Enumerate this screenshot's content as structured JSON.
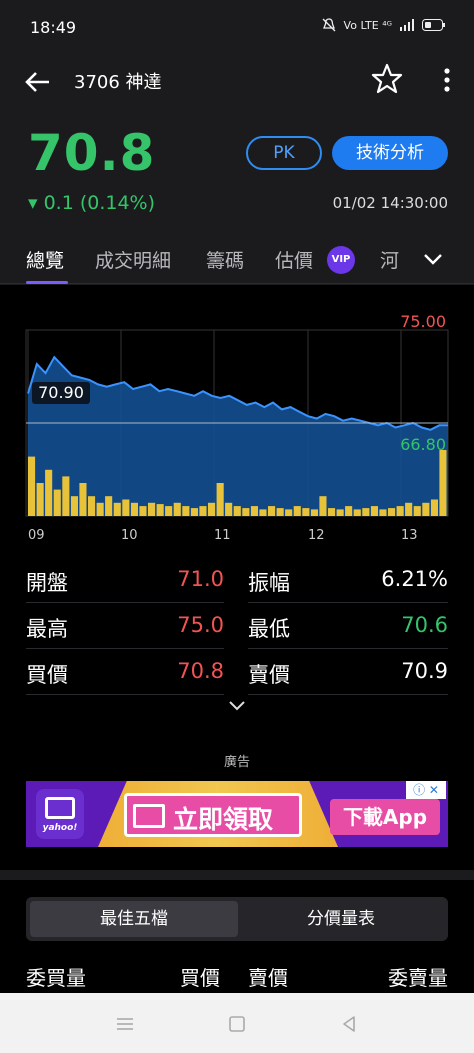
{
  "status_bar": {
    "time": "18:49",
    "indicators": "Vo LTE ⁴ᴳ"
  },
  "header": {
    "title": "3706 神達"
  },
  "quote": {
    "price": "70.8",
    "change": "▾ 0.1 (0.14%)",
    "pk_label": "PK",
    "tech_label": "技術分析",
    "timestamp": "01/02 14:30:00"
  },
  "tabs": [
    "總覽",
    "成交明細",
    "籌碼",
    "估價",
    "河"
  ],
  "vip_badge": "VIP",
  "chart_data": {
    "type": "area",
    "x_ticks": [
      "09",
      "10",
      "11",
      "12",
      "13"
    ],
    "reference_label": "70.90",
    "high_label": "75.00",
    "low_label": "66.80",
    "ylim": [
      66.8,
      75.0
    ],
    "reference": 70.9,
    "price_series": [
      72.2,
      73.5,
      73.1,
      73.8,
      73.4,
      73.0,
      72.9,
      72.8,
      72.6,
      72.5,
      72.6,
      72.7,
      72.4,
      72.5,
      72.6,
      72.3,
      72.4,
      72.3,
      72.2,
      72.1,
      72.3,
      72.1,
      72.0,
      72.1,
      71.9,
      71.7,
      71.8,
      71.6,
      71.8,
      71.5,
      71.6,
      71.4,
      71.2,
      71.1,
      71.3,
      71.2,
      71.0,
      71.1,
      71.0,
      70.9,
      70.8,
      70.9,
      70.7,
      70.8,
      70.9,
      70.7,
      70.6,
      70.8,
      70.8
    ],
    "volume_series": [
      0.9,
      0.5,
      0.7,
      0.4,
      0.6,
      0.3,
      0.5,
      0.3,
      0.2,
      0.3,
      0.2,
      0.25,
      0.2,
      0.15,
      0.2,
      0.18,
      0.15,
      0.2,
      0.15,
      0.12,
      0.15,
      0.2,
      0.5,
      0.2,
      0.15,
      0.12,
      0.15,
      0.1,
      0.15,
      0.12,
      0.1,
      0.15,
      0.12,
      0.1,
      0.3,
      0.12,
      0.1,
      0.15,
      0.1,
      0.12,
      0.15,
      0.1,
      0.12,
      0.15,
      0.2,
      0.15,
      0.2,
      0.25,
      1.0
    ]
  },
  "stats": {
    "open_label": "開盤",
    "open_value": "71.0",
    "amplitude_label": "振幅",
    "amplitude_value": "6.21%",
    "high_label": "最高",
    "high_value": "75.0",
    "low_label": "最低",
    "low_value": "70.6",
    "bid_label": "買價",
    "bid_value": "70.8",
    "ask_label": "賣價",
    "ask_value": "70.9"
  },
  "ad": {
    "label": "廣告",
    "brand": "yahoo!",
    "headline": "立即領取",
    "download": "下載App",
    "info": "ⓘ ✕"
  },
  "depth": {
    "tab_best5": "最佳五檔",
    "tab_volume": "分價量表",
    "col_bid_vol": "委買量",
    "col_bid": "買價",
    "col_ask": "賣價",
    "col_ask_vol": "委賣量"
  },
  "colors": {
    "up": "#f25454",
    "down": "#35c46a",
    "accent": "#1f7bf0",
    "line": "#3b93ff",
    "volume": "#e8c33a"
  }
}
